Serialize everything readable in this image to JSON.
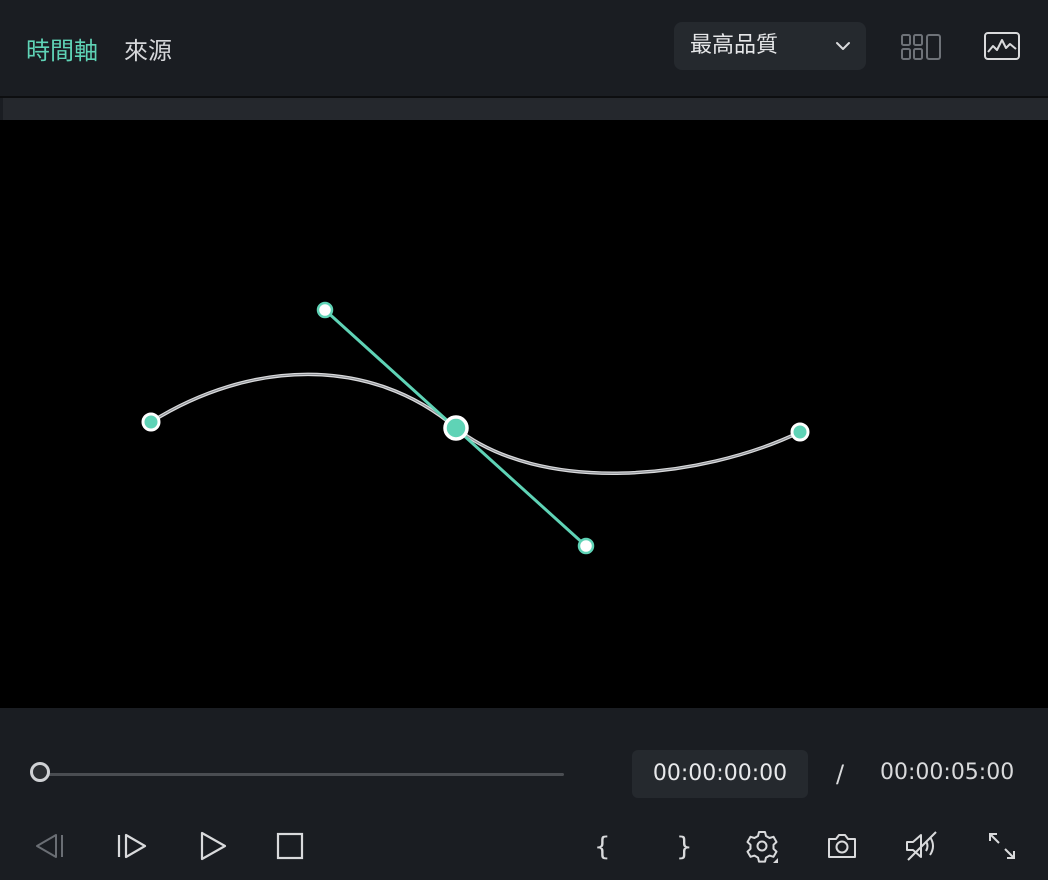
{
  "tabs": [
    {
      "label": "時間軸",
      "active": true
    },
    {
      "label": "來源",
      "active": false
    }
  ],
  "quality": {
    "selected": "最高品質"
  },
  "icons": {
    "grid": "grid-layout-icon",
    "scope": "waveform-monitor-icon"
  },
  "viewer": {
    "curve_color": "#5fd3b6",
    "background": "#000000"
  },
  "playback": {
    "current_time": "00:00:00:00",
    "separator": "/",
    "total_time": "00:00:05:00",
    "progress": 0
  },
  "controls": [
    "previous-frame-icon",
    "next-frame-icon",
    "play-icon",
    "stop-icon",
    "mark-in-icon",
    "mark-out-icon",
    "settings-icon",
    "snapshot-icon",
    "mute-icon",
    "fullscreen-icon"
  ],
  "colors": {
    "accent": "#5fd3b6",
    "panel": "#1a1d22",
    "field": "#25292e"
  }
}
